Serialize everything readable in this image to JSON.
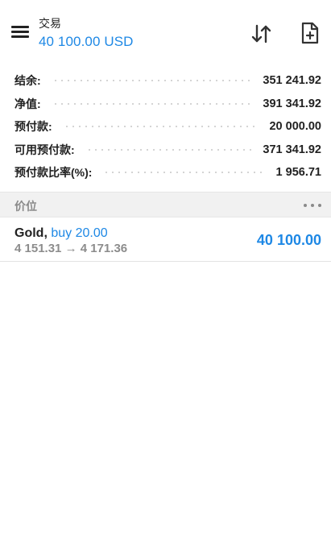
{
  "header": {
    "title": "交易",
    "balance_display": "40 100.00 USD",
    "icons": [
      "menu-icon",
      "sort-icon",
      "new-order-icon"
    ]
  },
  "summary": {
    "rows": [
      {
        "label": "结余:",
        "value": "351 241.92"
      },
      {
        "label": "净值:",
        "value": "391 341.92"
      },
      {
        "label": "预付款:",
        "value": "20 000.00"
      },
      {
        "label": "可用预付款:",
        "value": "371 341.92"
      },
      {
        "label": "预付款比率(%):",
        "value": "1 956.71"
      }
    ]
  },
  "positions_section": {
    "label": "价位",
    "more_icon": "more-horizontal-icon"
  },
  "positions": [
    {
      "symbol": "Gold,",
      "type": "buy 20.00",
      "open_price": "4 151.31",
      "arrow": "→",
      "current_price": "4 171.36",
      "profit": "40 100.00"
    }
  ],
  "colors": {
    "accent": "#1e88e5",
    "text": "#222222",
    "muted": "#8a8a8a",
    "section_bg": "#f1f1f1"
  }
}
